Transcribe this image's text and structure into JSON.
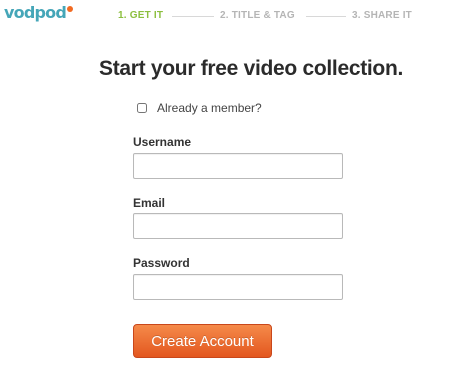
{
  "logo": {
    "text": "vodpod"
  },
  "steps": [
    {
      "label": "1. GET IT",
      "active": true
    },
    {
      "label": "2. TITLE & TAG",
      "active": false
    },
    {
      "label": "3. SHARE IT",
      "active": false
    }
  ],
  "colors": {
    "accent_active_step": "#8cbf3f",
    "inactive_step": "#b5b5b5",
    "button": "#e8622a",
    "logo": "#45a6b8",
    "logo_dot": "#f26a21"
  },
  "headline": "Start your free video collection.",
  "member_checkbox": {
    "label": "Already a member?",
    "checked": false
  },
  "form": {
    "username": {
      "label": "Username",
      "value": ""
    },
    "email": {
      "label": "Email",
      "value": ""
    },
    "password": {
      "label": "Password",
      "value": ""
    }
  },
  "submit_label": "Create Account"
}
